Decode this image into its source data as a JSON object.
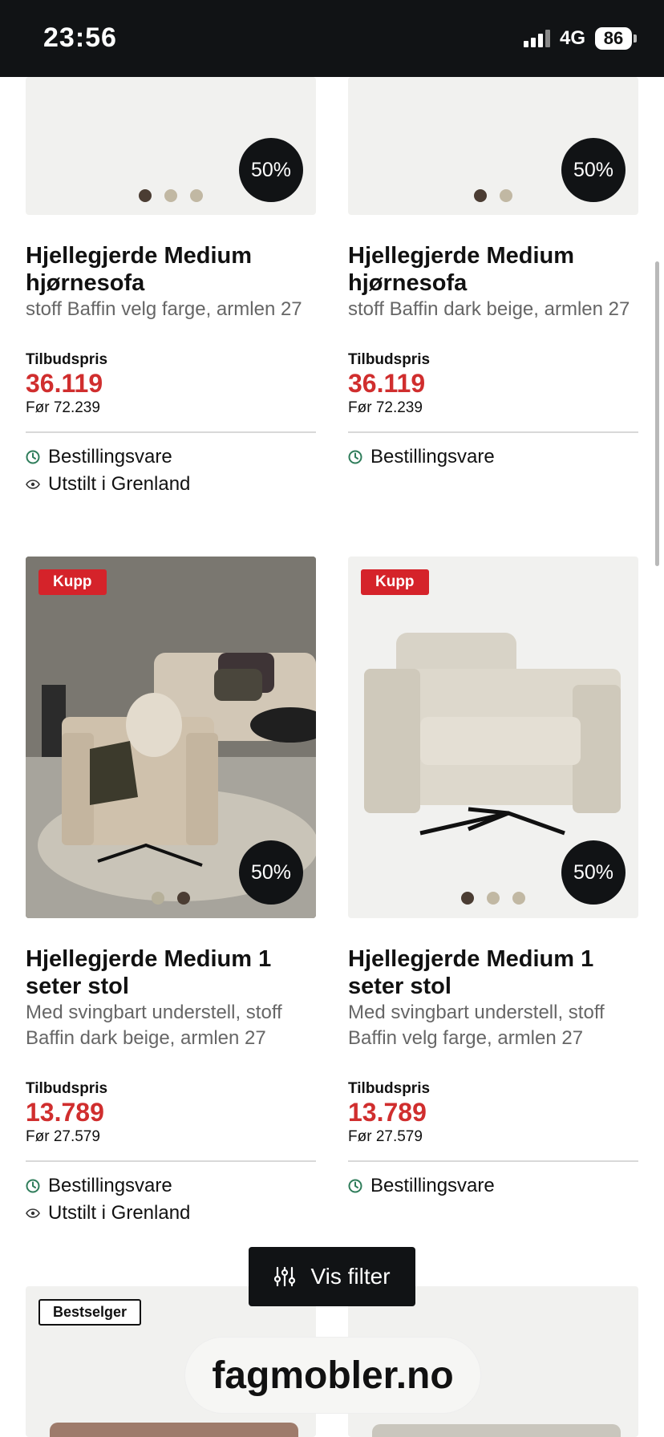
{
  "status_bar": {
    "time": "23:56",
    "network": "4G",
    "battery": "86"
  },
  "products": [
    {
      "title": "Hjellegjerde Medium hjørnesofa",
      "subtitle": "stoff Baffin velg farge, armlen 27",
      "price_label": "Tilbudspris",
      "price": "36.119",
      "before": "Før 72.239",
      "discount": "50%",
      "dots": 3,
      "active_dot": 1,
      "info": [
        "Bestillingsvare",
        "Utstilt i Grenland"
      ]
    },
    {
      "title": "Hjellegjerde Medium hjørnesofa",
      "subtitle": "stoff Baffin dark beige, armlen 27",
      "price_label": "Tilbudspris",
      "price": "36.119",
      "before": "Før 72.239",
      "discount": "50%",
      "dots": 2,
      "active_dot": 1,
      "info": [
        "Bestillingsvare"
      ]
    },
    {
      "badge": "Kupp",
      "title": "Hjellegjerde Medium 1 seter stol",
      "subtitle": "Med svingbart understell, stoff Baffin dark beige, armlen 27",
      "price_label": "Tilbudspris",
      "price": "13.789",
      "before": "Før 27.579",
      "discount": "50%",
      "dots": 2,
      "active_dot": 2,
      "info": [
        "Bestillingsvare",
        "Utstilt i Grenland"
      ]
    },
    {
      "badge": "Kupp",
      "title": "Hjellegjerde Medium 1 seter stol",
      "subtitle": "Med svingbart understell, stoff Baffin velg farge, armlen 27",
      "price_label": "Tilbudspris",
      "price": "13.789",
      "before": "Før 27.579",
      "discount": "50%",
      "dots": 3,
      "active_dot": 1,
      "info": [
        "Bestillingsvare"
      ]
    },
    {
      "badge": "Bestselger"
    }
  ],
  "filter_button": {
    "label": "Vis filter",
    "icon": "sliders-icon"
  },
  "site_domain": "fagmobler.no",
  "colors": {
    "price_red": "#d02e2e",
    "kupp_red": "#d5232a",
    "dark": "#111315",
    "clock_green": "#2f7d5b"
  }
}
